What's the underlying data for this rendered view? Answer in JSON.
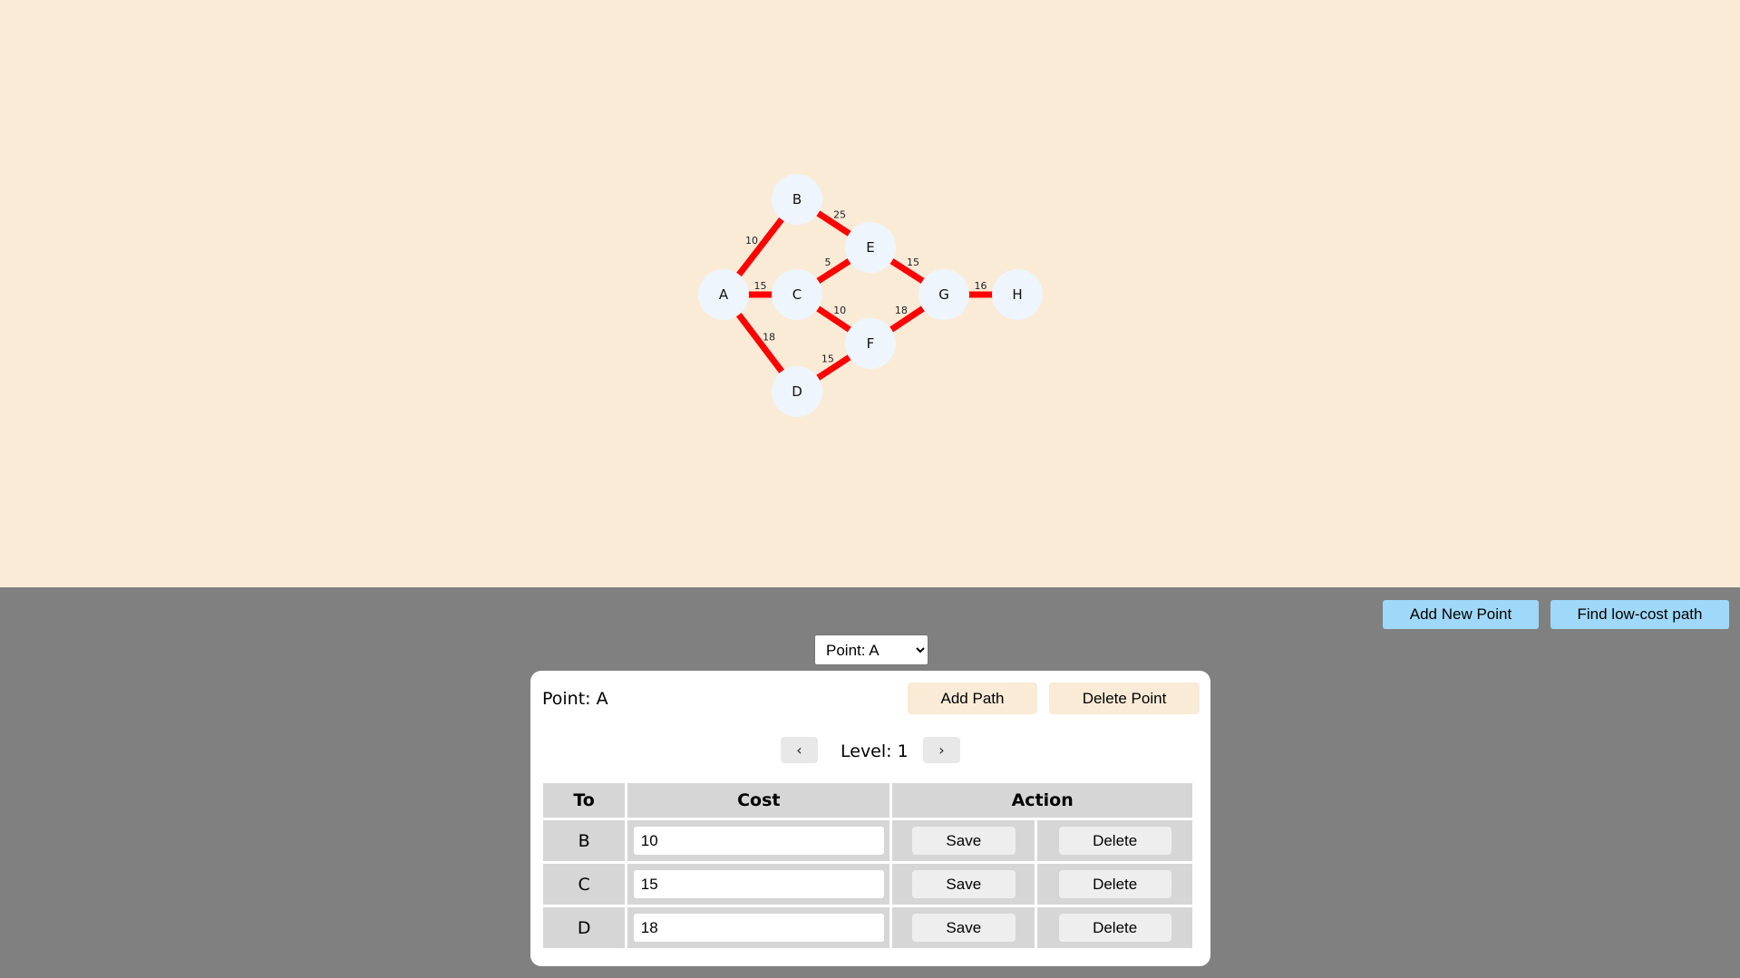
{
  "graph": {
    "nodes": [
      {
        "id": "A",
        "label": "A"
      },
      {
        "id": "B",
        "label": "B"
      },
      {
        "id": "C",
        "label": "C"
      },
      {
        "id": "D",
        "label": "D"
      },
      {
        "id": "E",
        "label": "E"
      },
      {
        "id": "F",
        "label": "F"
      },
      {
        "id": "G",
        "label": "G"
      },
      {
        "id": "H",
        "label": "H"
      }
    ],
    "edges": [
      {
        "from": "A",
        "to": "B",
        "cost": "10"
      },
      {
        "from": "A",
        "to": "C",
        "cost": "15"
      },
      {
        "from": "A",
        "to": "D",
        "cost": "18"
      },
      {
        "from": "B",
        "to": "E",
        "cost": "25"
      },
      {
        "from": "C",
        "to": "E",
        "cost": "5"
      },
      {
        "from": "C",
        "to": "F",
        "cost": "10"
      },
      {
        "from": "D",
        "to": "F",
        "cost": "15"
      },
      {
        "from": "E",
        "to": "G",
        "cost": "15"
      },
      {
        "from": "F",
        "to": "G",
        "cost": "18"
      },
      {
        "from": "G",
        "to": "H",
        "cost": "16"
      }
    ],
    "colors": {
      "background": "#faebd7",
      "edge": "#ff0000",
      "node_fill": "#eef5fc"
    }
  },
  "toolbar": {
    "add_point_label": "Add New Point",
    "find_path_label": "Find low-cost path"
  },
  "point_select": {
    "selected": "Point: A",
    "options": [
      "Point: A"
    ]
  },
  "panel": {
    "title": "Point: A",
    "add_path_label": "Add Path",
    "delete_point_label": "Delete Point",
    "level_prev_icon": "‹",
    "level_next_icon": "›",
    "level_text": "Level: 1",
    "table": {
      "headers": [
        "To",
        "Cost",
        "Action"
      ],
      "rows": [
        {
          "to": "B",
          "cost": "10",
          "save": "Save",
          "delete": "Delete"
        },
        {
          "to": "C",
          "cost": "15",
          "save": "Save",
          "delete": "Delete"
        },
        {
          "to": "D",
          "cost": "18",
          "save": "Save",
          "delete": "Delete"
        }
      ]
    }
  },
  "theme": {
    "control_background": "#808080",
    "primary_button": "#9fd8f8",
    "panel_button": "#faebd7"
  }
}
